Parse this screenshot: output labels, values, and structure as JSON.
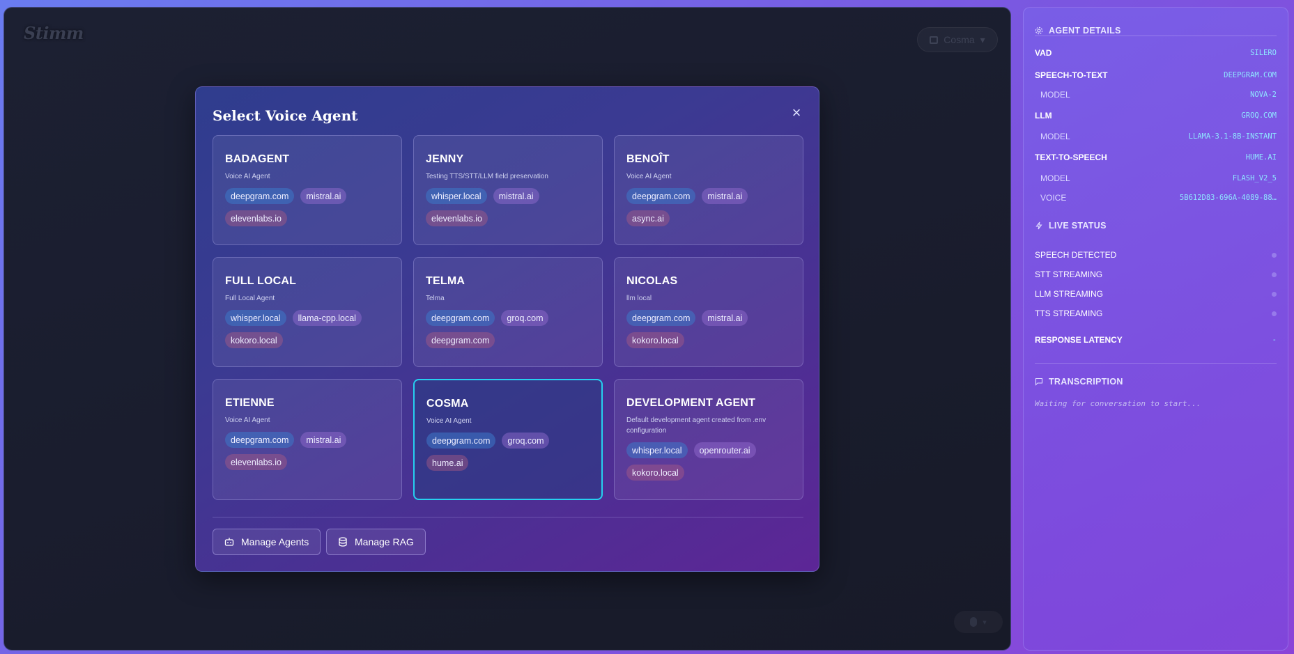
{
  "app": {
    "logo": "Stimm",
    "current_agent_chip": "Cosma",
    "mic_chevron": "▾"
  },
  "modal": {
    "title": "Select Voice Agent",
    "close_label": "×",
    "agents": [
      {
        "name": "BADAGENT",
        "description": "Voice AI Agent",
        "tags": [
          {
            "label": "deepgram.com",
            "kind": "stt"
          },
          {
            "label": "mistral.ai",
            "kind": "llm"
          },
          {
            "label": "elevenlabs.io",
            "kind": "tts"
          }
        ]
      },
      {
        "name": "JENNY",
        "description": "Testing TTS/STT/LLM field preservation",
        "tags": [
          {
            "label": "whisper.local",
            "kind": "stt"
          },
          {
            "label": "mistral.ai",
            "kind": "llm"
          },
          {
            "label": "elevenlabs.io",
            "kind": "tts"
          }
        ]
      },
      {
        "name": "BENOÎT",
        "description": "Voice AI Agent",
        "tags": [
          {
            "label": "deepgram.com",
            "kind": "stt"
          },
          {
            "label": "mistral.ai",
            "kind": "llm"
          },
          {
            "label": "async.ai",
            "kind": "tts"
          }
        ]
      },
      {
        "name": "FULL LOCAL",
        "description": "Full Local Agent",
        "tags": [
          {
            "label": "whisper.local",
            "kind": "stt"
          },
          {
            "label": "llama-cpp.local",
            "kind": "llm"
          },
          {
            "label": "kokoro.local",
            "kind": "tts"
          }
        ]
      },
      {
        "name": "TELMA",
        "description": "Telma",
        "tags": [
          {
            "label": "deepgram.com",
            "kind": "stt"
          },
          {
            "label": "groq.com",
            "kind": "llm"
          },
          {
            "label": "deepgram.com",
            "kind": "tts"
          }
        ]
      },
      {
        "name": "NICOLAS",
        "description": "llm local",
        "tags": [
          {
            "label": "deepgram.com",
            "kind": "stt"
          },
          {
            "label": "mistral.ai",
            "kind": "llm"
          },
          {
            "label": "kokoro.local",
            "kind": "tts"
          }
        ]
      },
      {
        "name": "ETIENNE",
        "description": "Voice AI Agent",
        "tags": [
          {
            "label": "deepgram.com",
            "kind": "stt"
          },
          {
            "label": "mistral.ai",
            "kind": "llm"
          },
          {
            "label": "elevenlabs.io",
            "kind": "tts"
          }
        ]
      },
      {
        "name": "COSMA",
        "description": "Voice AI Agent",
        "selected": true,
        "tags": [
          {
            "label": "deepgram.com",
            "kind": "stt"
          },
          {
            "label": "groq.com",
            "kind": "llm"
          },
          {
            "label": "hume.ai",
            "kind": "tts"
          }
        ]
      },
      {
        "name": "DEVELOPMENT AGENT",
        "description": "Default development agent created from .env configuration",
        "tags": [
          {
            "label": "whisper.local",
            "kind": "stt"
          },
          {
            "label": "openrouter.ai",
            "kind": "llm"
          },
          {
            "label": "kokoro.local",
            "kind": "tts"
          }
        ]
      }
    ],
    "manage_agents_label": "Manage Agents",
    "manage_rag_label": "Manage RAG"
  },
  "sidebar": {
    "agent_details": {
      "title": "AGENT DETAILS",
      "vad_label": "VAD",
      "vad_value": "SILERO",
      "stt_label": "SPEECH-TO-TEXT",
      "stt_value": "DEEPGRAM.COM",
      "stt_model_label": "MODEL",
      "stt_model_value": "NOVA-2",
      "llm_label": "LLM",
      "llm_value": "GROQ.COM",
      "llm_model_label": "MODEL",
      "llm_model_value": "LLAMA-3.1-8B-INSTANT",
      "tts_label": "TEXT-TO-SPEECH",
      "tts_value": "HUME.AI",
      "tts_model_label": "MODEL",
      "tts_model_value": "FLASH_V2_5",
      "voice_label": "VOICE",
      "voice_value": "5B612D83-696A-4089-88…"
    },
    "live_status": {
      "title": "LIVE STATUS",
      "speech_detected": "SPEECH DETECTED",
      "stt_streaming": "STT STREAMING",
      "llm_streaming": "LLM STREAMING",
      "tts_streaming": "TTS STREAMING",
      "response_latency_label": "RESPONSE LATENCY",
      "response_latency_value": "-"
    },
    "transcription": {
      "title": "TRANSCRIPTION",
      "placeholder": "Waiting for conversation to start..."
    }
  },
  "colors": {
    "selected_border": "#26d0f0",
    "value_text": "#8fe6ff"
  }
}
